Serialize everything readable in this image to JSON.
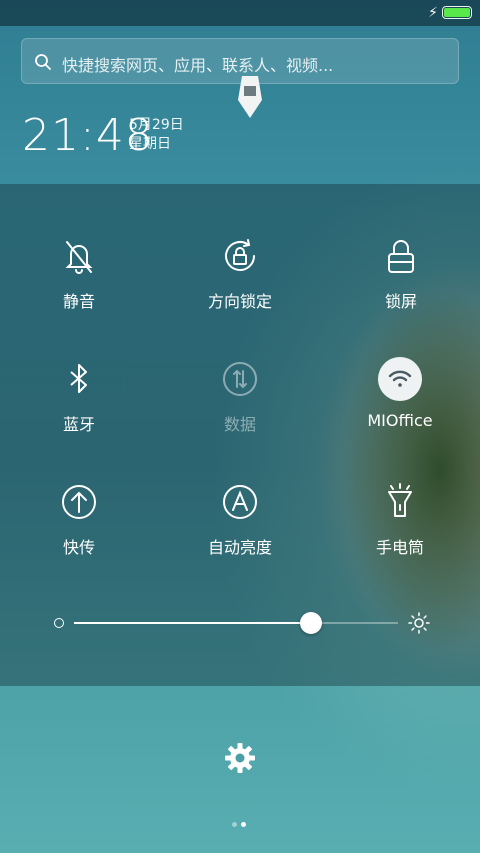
{
  "search": {
    "placeholder": "快捷搜索网页、应用、联系人、视频..."
  },
  "clock": {
    "time": "21:48",
    "date": "5月29日",
    "weekday": "星期日"
  },
  "toggles": [
    {
      "label": "静音",
      "icon": "bell-off-icon",
      "active": false
    },
    {
      "label": "方向锁定",
      "icon": "rotation-lock-icon",
      "active": false
    },
    {
      "label": "锁屏",
      "icon": "lock-icon",
      "active": false
    },
    {
      "label": "蓝牙",
      "icon": "bluetooth-icon",
      "active": false
    },
    {
      "label": "数据",
      "icon": "mobile-data-icon",
      "active": false,
      "disabled": true
    },
    {
      "label": "MIOffice",
      "icon": "wifi-icon",
      "active": true
    },
    {
      "label": "快传",
      "icon": "quick-transfer-icon",
      "active": false
    },
    {
      "label": "自动亮度",
      "icon": "auto-brightness-icon",
      "active": false
    },
    {
      "label": "手电筒",
      "icon": "flashlight-icon",
      "active": false
    }
  ],
  "brightness": {
    "value": 0.73
  },
  "pager": {
    "count": 2,
    "current": 1
  },
  "colors": {
    "battery": "#59e84a",
    "accent": "#ffffff"
  }
}
